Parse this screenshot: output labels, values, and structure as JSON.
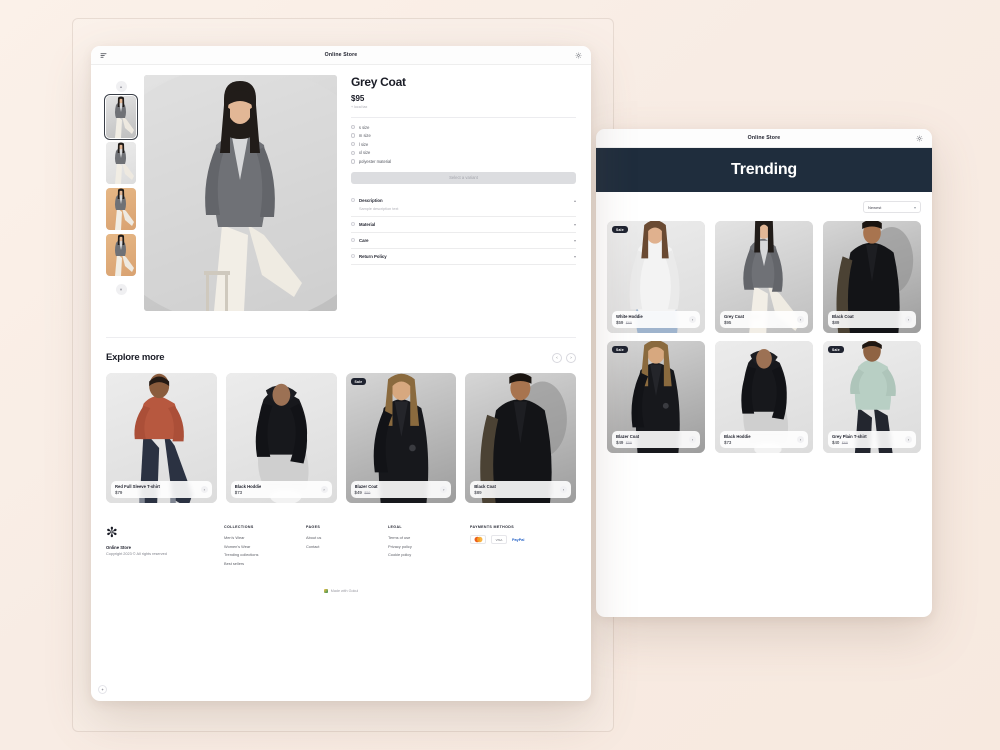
{
  "app": {
    "title": "Online Store",
    "menu_icon": "menu-icon",
    "settings_icon": "gear-icon"
  },
  "product_window": {
    "titlebar": {
      "title": "Online Store"
    },
    "gallery": {
      "up_icon": "chevron-up-icon",
      "down_icon": "chevron-down-icon",
      "thumbnails": [
        {
          "alt": "Grey coat front view",
          "selected": true
        },
        {
          "alt": "Grey coat seated view",
          "selected": false
        },
        {
          "alt": "Grey coat tan backdrop",
          "selected": false
        },
        {
          "alt": "Grey coat side view",
          "selected": false
        }
      ]
    },
    "details": {
      "title": "Grey Coat",
      "price": "$95",
      "subtitle": "+ local tax",
      "options": [
        {
          "label": "s size"
        },
        {
          "label": "m size"
        },
        {
          "label": "l size"
        },
        {
          "label": "xl size"
        },
        {
          "label": "polyester material"
        }
      ],
      "cta_label": "Select a variant",
      "accordions": [
        {
          "title": "Description",
          "body": "Sample description text",
          "expanded": true,
          "chevron": "chevron-up-icon"
        },
        {
          "title": "Material",
          "body": "",
          "expanded": false,
          "chevron": "chevron-down-icon"
        },
        {
          "title": "Care",
          "body": "",
          "expanded": false,
          "chevron": "chevron-down-icon"
        },
        {
          "title": "Return Policy",
          "body": "",
          "expanded": false,
          "chevron": "chevron-down-icon"
        }
      ]
    },
    "explore": {
      "title": "Explore more",
      "prev_icon": "chevron-left-icon",
      "next_icon": "chevron-right-icon",
      "products": [
        {
          "name": "Red Full Sleeve T-shirt",
          "price": "$79",
          "old_price": "",
          "badge": "",
          "go_icon": "chevron-right-icon"
        },
        {
          "name": "Black Hoddie",
          "price": "$73",
          "old_price": "",
          "badge": "",
          "go_icon": "chevron-right-icon"
        },
        {
          "name": "Blazer Coat",
          "price": "$49",
          "old_price": "$59",
          "badge": "Sale",
          "go_icon": "chevron-right-icon"
        },
        {
          "name": "Black Coat",
          "price": "$89",
          "old_price": "",
          "badge": "",
          "go_icon": "chevron-right-icon"
        }
      ]
    },
    "footer": {
      "logo_icon": "asterisk-logo-icon",
      "brand": "Online Store",
      "copyright": "Copyright 2023 © All rights reserved",
      "columns": [
        {
          "heading": "COLLECTIONS",
          "links": [
            "Men's Wear",
            "Women's Wear",
            "Trending collections",
            "Best sellers"
          ]
        },
        {
          "heading": "PAGES",
          "links": [
            "About us",
            "Contact"
          ]
        },
        {
          "heading": "LEGAL",
          "links": [
            "Terms of use",
            "Privacy policy",
            "Cookie policy"
          ]
        }
      ],
      "payments": {
        "heading": "PAYMENTS METHODS",
        "methods": [
          {
            "name": "mastercard-icon",
            "label": ""
          },
          {
            "name": "visa-icon",
            "label": "VISA"
          },
          {
            "name": "paypal-icon",
            "label": "PayPal"
          }
        ]
      },
      "made_with": "Made with Gokul",
      "made_icon": "sparkle-icon"
    },
    "corner_button_icon": "sparkle-icon"
  },
  "trending_window": {
    "titlebar": {
      "title": "Online Store",
      "settings_icon": "gear-icon"
    },
    "hero_title": "Trending",
    "sort": {
      "value": "Newest",
      "chevron": "chevron-down-icon"
    },
    "products": [
      {
        "name": "White Hoddie",
        "price": "$59",
        "old_price": "$69",
        "badge": "Sale",
        "go_icon": "chevron-right-icon"
      },
      {
        "name": "Grey Coat",
        "price": "$95",
        "old_price": "",
        "badge": "",
        "go_icon": "chevron-right-icon"
      },
      {
        "name": "Black Coat",
        "price": "$89",
        "old_price": "",
        "badge": "",
        "go_icon": "chevron-right-icon"
      },
      {
        "name": "Blazer Coat",
        "price": "$49",
        "old_price": "$59",
        "badge": "Sale",
        "go_icon": "chevron-right-icon"
      },
      {
        "name": "Black Hoddie",
        "price": "$73",
        "old_price": "",
        "badge": "",
        "go_icon": "chevron-right-icon"
      },
      {
        "name": "Grey Plain T-shirt",
        "price": "$40",
        "old_price": "$69",
        "badge": "Sale",
        "go_icon": "chevron-right-icon"
      }
    ]
  },
  "colors": {
    "hero_navy": "#1f2d3d",
    "page_bg": "#f9ece2",
    "text_dark": "#1d1f2b",
    "muted": "#9b9ba3"
  }
}
